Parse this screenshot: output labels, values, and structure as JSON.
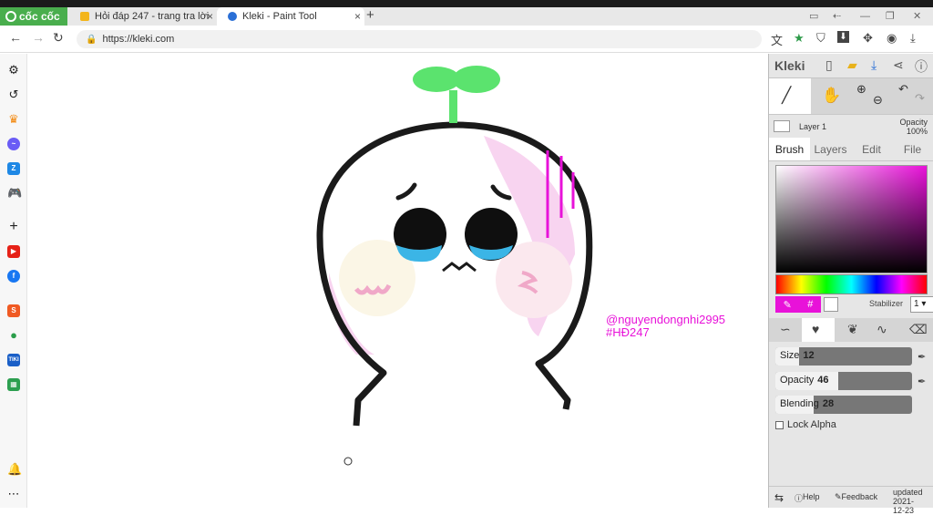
{
  "browser": {
    "brand": "cốc cốc",
    "tabs": [
      {
        "title": "Hỏi đáp 247 - trang tra lời",
        "close": "×"
      },
      {
        "title": "Kleki - Paint Tool",
        "close": "×"
      }
    ],
    "new_tab": "+",
    "url": "https://kleki.com"
  },
  "leftbar": {
    "items": [
      "settings-icon",
      "history-icon",
      "crown-icon",
      "messenger-icon",
      "zalo-icon",
      "game-icon",
      "add-icon",
      "youtube-icon",
      "facebook-icon",
      "shopee-icon",
      "coccoc-icon",
      "tiki-icon",
      "sheet-icon",
      "bell-icon",
      "more-icon"
    ],
    "tiki_label": "TIKI"
  },
  "canvas": {
    "watermark_user": "@nguyendongnhi2995",
    "watermark_tag": "#HĐ247",
    "colors": {
      "sprout": "#5be36e",
      "outline": "#1a1a1a",
      "pink": "#f5c6ec",
      "tear": "#3bb5e6",
      "magenta": "#e812d9"
    }
  },
  "kleki": {
    "logo": "Kleki",
    "layer_name": "Layer 1",
    "layer_opacity_label": "Opacity",
    "layer_opacity_value": "100%",
    "tabs": [
      "Brush",
      "Layers",
      "Edit",
      "File"
    ],
    "active_tab": "Brush",
    "color_hex_symbol": "#",
    "current_color": "#e812d9",
    "stabilizer_label": "Stabilizer",
    "stabilizer_value": "1",
    "size_label": "Size",
    "size_value": "12",
    "size_fraction": 0.17,
    "opacity_label": "Opacity",
    "opacity_value": "46",
    "opacity_fraction": 0.46,
    "blending_label": "Blending",
    "blending_value": "28",
    "blending_fraction": 0.28,
    "lock_alpha_label": "Lock Alpha",
    "help_label": "Help",
    "feedback_label": "Feedback",
    "updated_label": "updated",
    "updated_date": "2021-12-23"
  }
}
